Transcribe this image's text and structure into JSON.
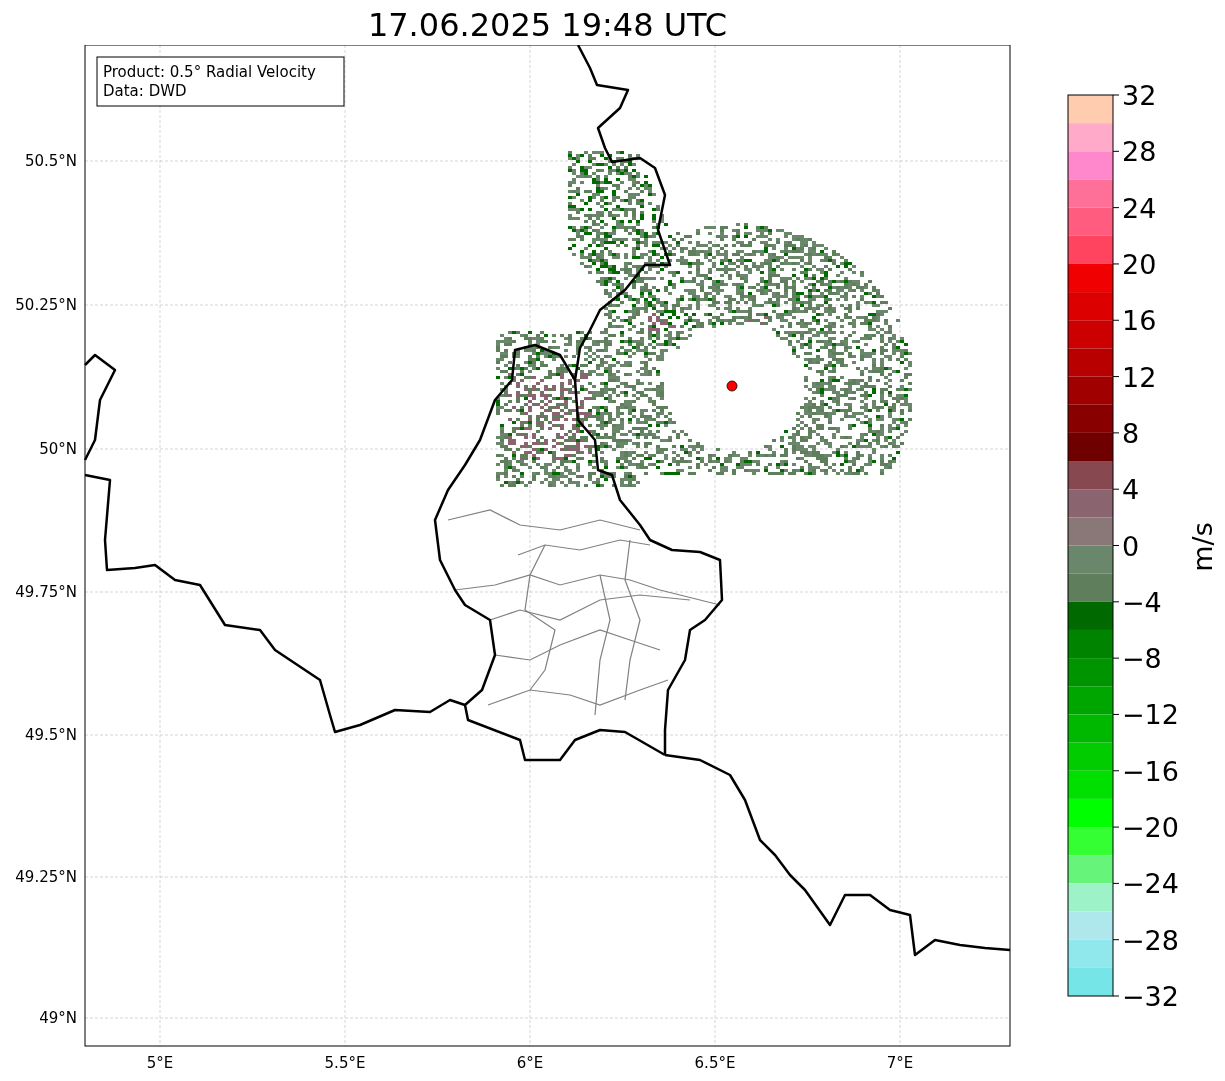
{
  "title": "17.06.2025 19:48 UTC",
  "info_box": {
    "lines": [
      "Product: 0.5° Radial Velocity",
      "Data: DWD"
    ]
  },
  "latitude_labels": [
    "50.5°N",
    "50.25°N",
    "50°N",
    "49.75°N",
    "49.5°N",
    "49.25°N",
    "49°N"
  ],
  "longitude_labels": [
    "5°E",
    "5.5°E",
    "6°E",
    "6.5°E",
    "7°E"
  ],
  "colorbar": {
    "label": "m/s",
    "ticks": [
      "32",
      "28",
      "24",
      "20",
      "16",
      "12",
      "8",
      "4",
      "0",
      "−4",
      "−8",
      "−12",
      "−16",
      "−20",
      "−24",
      "−28",
      "−32"
    ],
    "bins": [
      {
        "color": "#ffccb0"
      },
      {
        "color": "#ffaac8"
      },
      {
        "color": "#ff88cc"
      },
      {
        "color": "#ff7099"
      },
      {
        "color": "#ff5c80"
      },
      {
        "color": "#ff4460"
      },
      {
        "color": "#f00000"
      },
      {
        "color": "#dc0000"
      },
      {
        "color": "#cc0000"
      },
      {
        "color": "#b80000"
      },
      {
        "color": "#a00000"
      },
      {
        "color": "#880000"
      },
      {
        "color": "#700000"
      },
      {
        "color": "#884850"
      },
      {
        "color": "#8a6570"
      },
      {
        "color": "#8a7878"
      },
      {
        "color": "#6b876b"
      },
      {
        "color": "#5e7e5c"
      },
      {
        "color": "#006a00"
      },
      {
        "color": "#008400"
      },
      {
        "color": "#009400"
      },
      {
        "color": "#00a600"
      },
      {
        "color": "#00b800"
      },
      {
        "color": "#00cc00"
      },
      {
        "color": "#00e000"
      },
      {
        "color": "#00ff00"
      },
      {
        "color": "#33ff33"
      },
      {
        "color": "#66f57a"
      },
      {
        "color": "#9ef2c8"
      },
      {
        "color": "#aee8ec"
      },
      {
        "color": "#90e8ec"
      },
      {
        "color": "#76e5e8"
      }
    ]
  }
}
